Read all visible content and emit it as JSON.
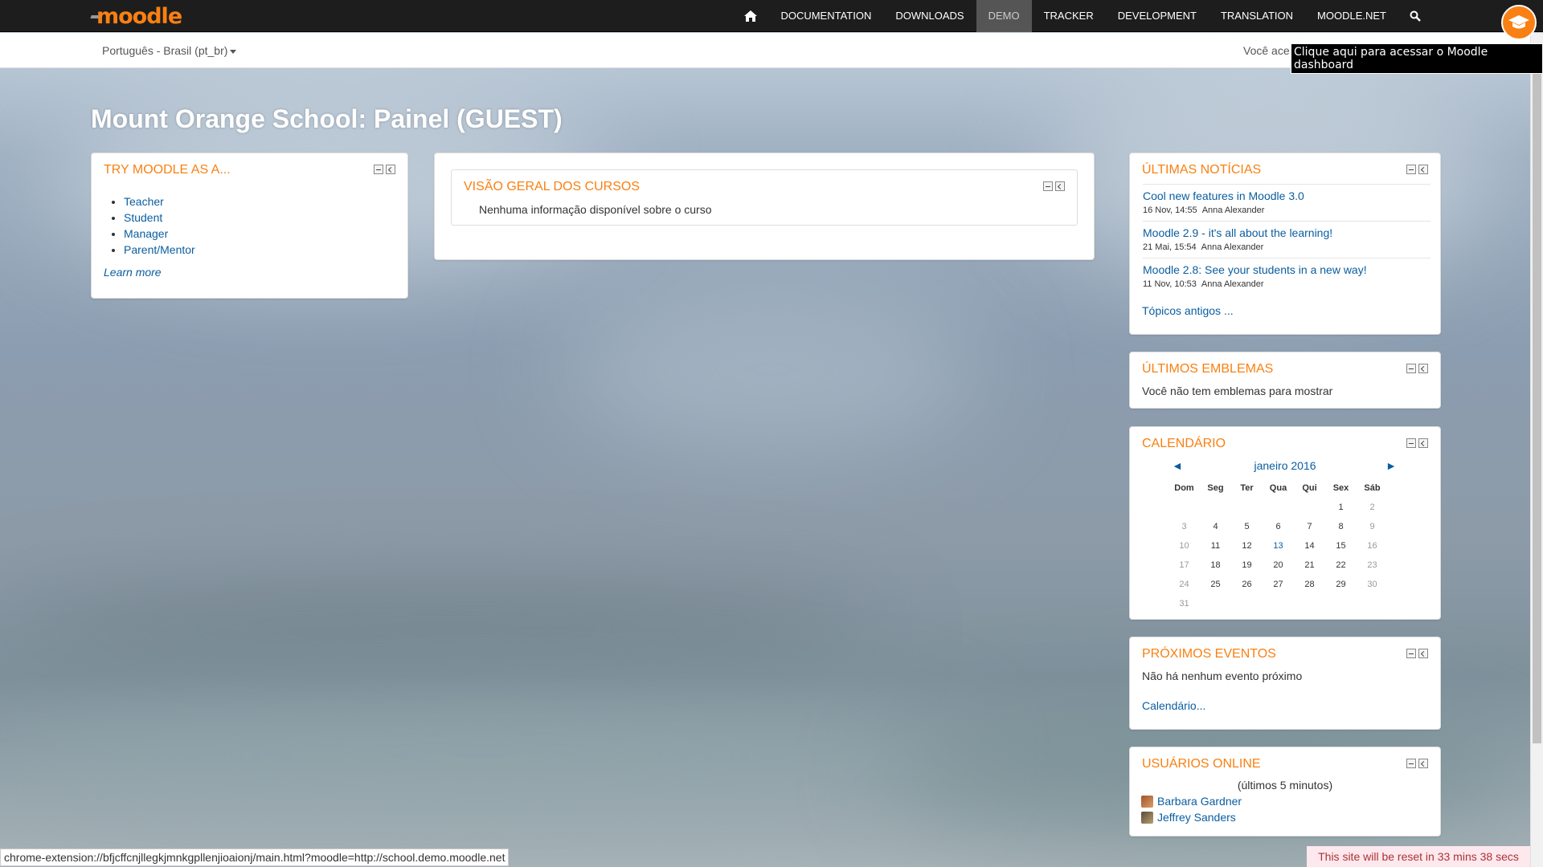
{
  "nav": {
    "logo": "moodle",
    "items": [
      "DOCUMENTATION",
      "DOWNLOADS",
      "DEMO",
      "TRACKER",
      "DEVELOPMENT",
      "TRANSLATION",
      "MOODLE.NET"
    ],
    "active": "DEMO"
  },
  "subbar": {
    "language": "Português - Brasil (pt_br)",
    "login_info": "Você ace",
    "tooltip": "Clique aqui para acessar o Moodle dashboard"
  },
  "page_title": "Mount Orange School: Painel (GUEST)",
  "try_moodle": {
    "title": "TRY MOODLE AS A...",
    "items": [
      "Teacher",
      "Student",
      "Manager",
      "Parent/Mentor"
    ],
    "learn_more": "Learn more"
  },
  "course_overview": {
    "title": "VISÃO GERAL DOS CURSOS",
    "empty_text": "Nenhuma informação disponível sobre o curso"
  },
  "news": {
    "title": "ÚLTIMAS NOTÍCIAS",
    "items": [
      {
        "title": "Cool new features in Moodle 3.0",
        "date": "16 Nov, 14:55",
        "author": "Anna Alexander"
      },
      {
        "title": "Moodle 2.9 - it's all about the learning!",
        "date": "21 Mai, 15:54",
        "author": "Anna Alexander"
      },
      {
        "title": "Moodle 2.8: See your students in a new way!",
        "date": "11 Nov, 10:53",
        "author": "Anna Alexander"
      }
    ],
    "older": "Tópicos antigos ..."
  },
  "badges": {
    "title": "ÚLTIMOS EMBLEMAS",
    "text": "Você não tem emblemas para mostrar"
  },
  "calendar": {
    "title": "CALENDÁRIO",
    "month": "janeiro 2016",
    "prev": "◄",
    "next": "►",
    "days": [
      "Dom",
      "Seg",
      "Ter",
      "Qua",
      "Qui",
      "Sex",
      "Sáb"
    ],
    "weeks": [
      [
        "",
        "",
        "",
        "",
        "",
        "1",
        "2"
      ],
      [
        "3",
        "4",
        "5",
        "6",
        "7",
        "8",
        "9"
      ],
      [
        "10",
        "11",
        "12",
        "13",
        "14",
        "15",
        "16"
      ],
      [
        "17",
        "18",
        "19",
        "20",
        "21",
        "22",
        "23"
      ],
      [
        "24",
        "25",
        "26",
        "27",
        "28",
        "29",
        "30"
      ],
      [
        "31",
        "",
        "",
        "",
        "",
        "",
        ""
      ]
    ],
    "today": "13"
  },
  "events": {
    "title": "PRÓXIMOS EVENTOS",
    "text": "Não há nenhum evento próximo",
    "link": "Calendário..."
  },
  "online_users": {
    "title": "USUÁRIOS ONLINE",
    "note": "(últimos 5 minutos)",
    "users": [
      "Barbara Gardner",
      "Jeffrey Sanders"
    ]
  },
  "status_url": "chrome-extension://bfjcffcnjllegkjmnkgpllenjioaionj/main.html?moodle=http://school.demo.moodle.net",
  "reset_banner": "This site will be reset in 33 mins 38 secs",
  "colors": {
    "accent": "#f98012",
    "link": "#0a5ea0",
    "navbar": "#1d1d1d"
  }
}
